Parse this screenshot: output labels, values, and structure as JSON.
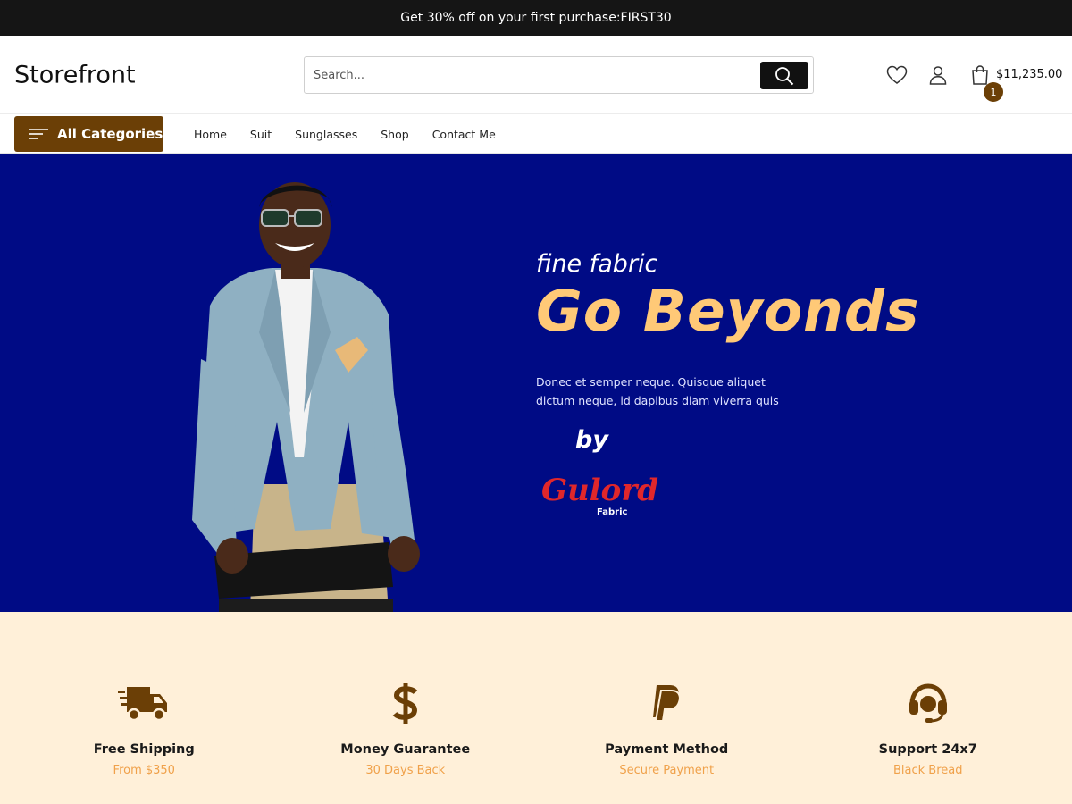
{
  "topbar": {
    "promo": "Get 30% off on your first purchase:FIRST30"
  },
  "header": {
    "logo": "Storefront",
    "search_placeholder": "Search...",
    "cart_count": "1",
    "cart_total": "$11,235.00"
  },
  "nav": {
    "all_categories": "All Categories",
    "links": [
      "Home",
      "Suit",
      "Sunglasses",
      "Shop",
      "Contact Me"
    ]
  },
  "hero": {
    "eyebrow": "fine fabric",
    "headline": "Go Beyonds",
    "description": "Donec et semper neque. Quisque aliquet dictum neque, id dapibus diam viverra quis",
    "by": "by",
    "brand_name": "Gulord",
    "brand_sub": "Fabric"
  },
  "features": [
    {
      "icon": "truck-icon",
      "title": "Free Shipping",
      "subtitle": "From $350"
    },
    {
      "icon": "dollar-icon",
      "title": "Money Guarantee",
      "subtitle": "30 Days Back"
    },
    {
      "icon": "paypal-icon",
      "title": "Payment Method",
      "subtitle": "Secure Payment"
    },
    {
      "icon": "headset-icon",
      "title": "Support 24x7",
      "subtitle": "Black Bread"
    }
  ],
  "colors": {
    "topbar": "#151515",
    "accent_brown": "#6b3f06",
    "hero_bg": "#000b85",
    "headline": "#ffc977",
    "features_bg": "#fff0d9",
    "feature_sub": "#f0a14a"
  }
}
